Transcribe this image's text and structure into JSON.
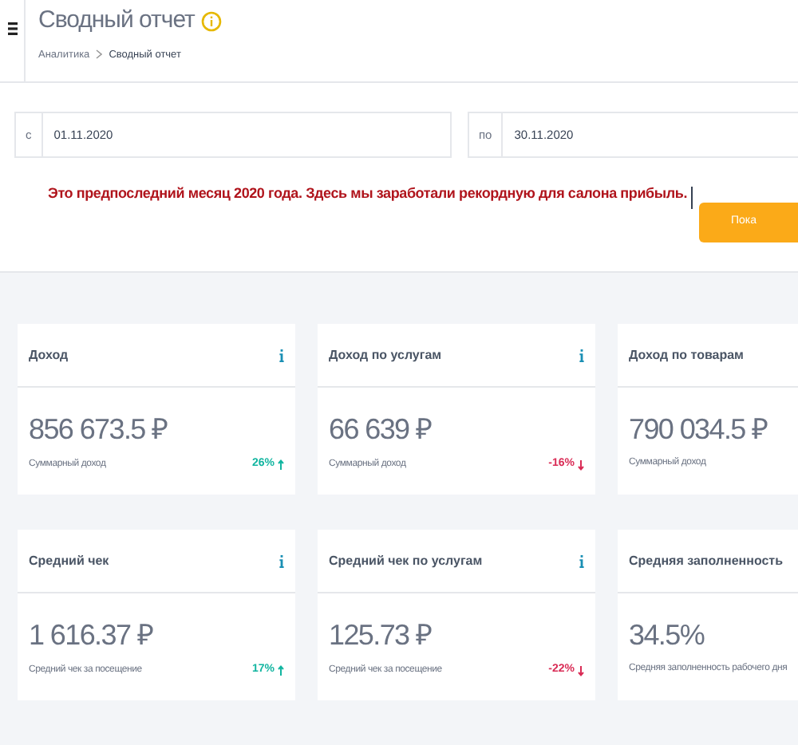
{
  "header": {
    "title": "Сводный отчет",
    "breadcrumbs": [
      "Аналитика",
      "Сводный отчет"
    ]
  },
  "date_range": [
    {
      "prefix": "с",
      "value": "01.11.2020"
    },
    {
      "prefix": "по",
      "value": "30.11.2020"
    }
  ],
  "annotation": "Это предпоследний месяц 2020 года. Здесь мы заработали рекордную для салона прибыль.",
  "button": {
    "label": "Пока"
  },
  "cards": [
    {
      "title": "Доход",
      "info": true,
      "value": "856 673.5 ₽",
      "caption": "Суммарный доход",
      "trend": {
        "text": "26%",
        "rising": true
      }
    },
    {
      "title": "Доход по услугам",
      "info": true,
      "value": "66 639 ₽",
      "caption": "Суммарный доход",
      "trend": {
        "text": "-16%",
        "rising": false
      }
    },
    {
      "title": "Доход по товарам",
      "info": false,
      "value": "790 034.5 ₽",
      "caption": "Суммарный доход"
    },
    {
      "title": "Средний чек",
      "info": true,
      "value": "1 616.37 ₽",
      "caption": "Средний чек за посещение",
      "trend": {
        "text": "17%",
        "rising": true
      }
    },
    {
      "title": "Средний чек по услугам",
      "info": true,
      "value": "125.73 ₽",
      "caption": "Средний чек за посещение",
      "trend": {
        "text": "-22%",
        "rising": false
      }
    },
    {
      "title": "Средняя заполненность",
      "info": false,
      "value": "34.5%",
      "caption": "Средняя заполненность рабочего дня"
    }
  ]
}
